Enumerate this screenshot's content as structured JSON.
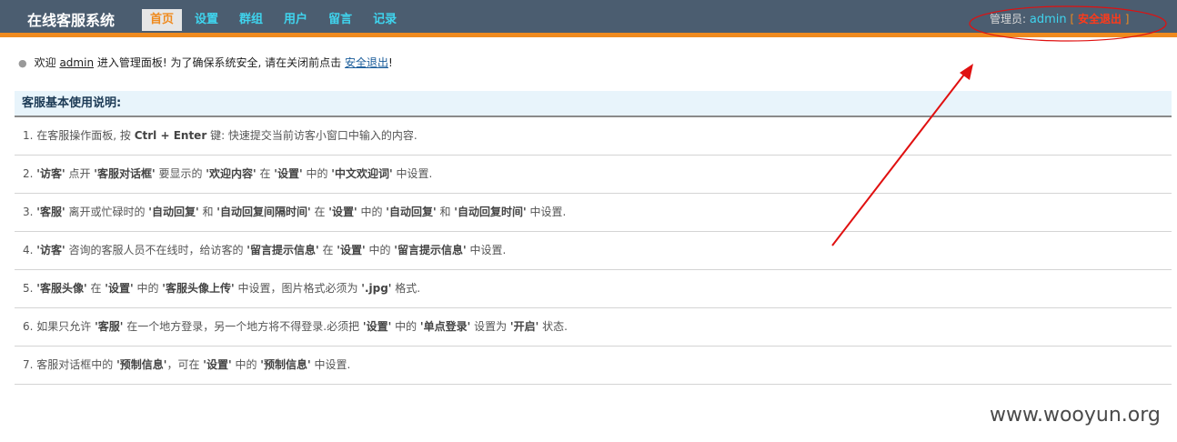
{
  "header": {
    "app_title": "在线客服系统",
    "nav": [
      {
        "label": "首页"
      },
      {
        "label": "设置"
      },
      {
        "label": "群组"
      },
      {
        "label": "用户"
      },
      {
        "label": "留言"
      },
      {
        "label": "记录"
      }
    ],
    "admin_label": "管理员:",
    "admin_name": "admin",
    "bracket_open": "[",
    "logout_label": "安全退出",
    "bracket_close": "]"
  },
  "welcome": {
    "prefix": "欢迎",
    "user": "admin",
    "middle": "进入管理面板! 为了确保系统安全, 请在关闭前点击",
    "link": "安全退出",
    "suffix": "!"
  },
  "instructions": {
    "title": "客服基本使用说明:",
    "items": [
      [
        {
          "t": "1. 在客服操作面板, 按 "
        },
        {
          "t": "Ctrl + Enter",
          "b": true
        },
        {
          "t": " 键: 快速提交当前访客小窗口中输入的内容."
        }
      ],
      [
        {
          "t": "2. "
        },
        {
          "t": "'访客'",
          "b": true
        },
        {
          "t": " 点开 "
        },
        {
          "t": "'客服对话框'",
          "b": true
        },
        {
          "t": " 要显示的 "
        },
        {
          "t": "'欢迎内容'",
          "b": true
        },
        {
          "t": " 在 "
        },
        {
          "t": "'设置'",
          "b": true
        },
        {
          "t": " 中的 "
        },
        {
          "t": "'中文欢迎词'",
          "b": true
        },
        {
          "t": " 中设置."
        }
      ],
      [
        {
          "t": "3. "
        },
        {
          "t": "'客服'",
          "b": true
        },
        {
          "t": " 离开或忙碌时的 "
        },
        {
          "t": "'自动回复'",
          "b": true
        },
        {
          "t": " 和 "
        },
        {
          "t": "'自动回复间隔时间'",
          "b": true
        },
        {
          "t": " 在 "
        },
        {
          "t": "'设置'",
          "b": true
        },
        {
          "t": " 中的 "
        },
        {
          "t": "'自动回复'",
          "b": true
        },
        {
          "t": " 和 "
        },
        {
          "t": "'自动回复时间'",
          "b": true
        },
        {
          "t": " 中设置."
        }
      ],
      [
        {
          "t": "4. "
        },
        {
          "t": "'访客'",
          "b": true
        },
        {
          "t": " 咨询的客服人员不在线时，给访客的 "
        },
        {
          "t": "'留言提示信息'",
          "b": true
        },
        {
          "t": " 在 "
        },
        {
          "t": "'设置'",
          "b": true
        },
        {
          "t": " 中的 "
        },
        {
          "t": "'留言提示信息'",
          "b": true
        },
        {
          "t": " 中设置."
        }
      ],
      [
        {
          "t": "5. "
        },
        {
          "t": "'客服头像'",
          "b": true
        },
        {
          "t": " 在 "
        },
        {
          "t": "'设置'",
          "b": true
        },
        {
          "t": " 中的 "
        },
        {
          "t": "'客服头像上传'",
          "b": true
        },
        {
          "t": " 中设置，图片格式必须为 "
        },
        {
          "t": "'.jpg'",
          "b": true
        },
        {
          "t": " 格式."
        }
      ],
      [
        {
          "t": "6. 如果只允许 "
        },
        {
          "t": "'客服'",
          "b": true
        },
        {
          "t": " 在一个地方登录，另一个地方将不得登录.必须把 "
        },
        {
          "t": "'设置'",
          "b": true
        },
        {
          "t": " 中的 "
        },
        {
          "t": "'单点登录'",
          "b": true
        },
        {
          "t": " 设置为 "
        },
        {
          "t": "'开启'",
          "b": true
        },
        {
          "t": " 状态."
        }
      ],
      [
        {
          "t": "7. 客服对话框中的 "
        },
        {
          "t": "'预制信息'",
          "b": true
        },
        {
          "t": "，可在 "
        },
        {
          "t": "'设置'",
          "b": true
        },
        {
          "t": " 中的 "
        },
        {
          "t": "'预制信息'",
          "b": true
        },
        {
          "t": " 中设置."
        }
      ]
    ]
  },
  "watermark": "www.wooyun.org",
  "colors": {
    "topbar": "#4b5d70",
    "accent_orange": "#ef8a1e",
    "nav_link": "#3fd4ee",
    "annotation_red": "#e01010"
  }
}
